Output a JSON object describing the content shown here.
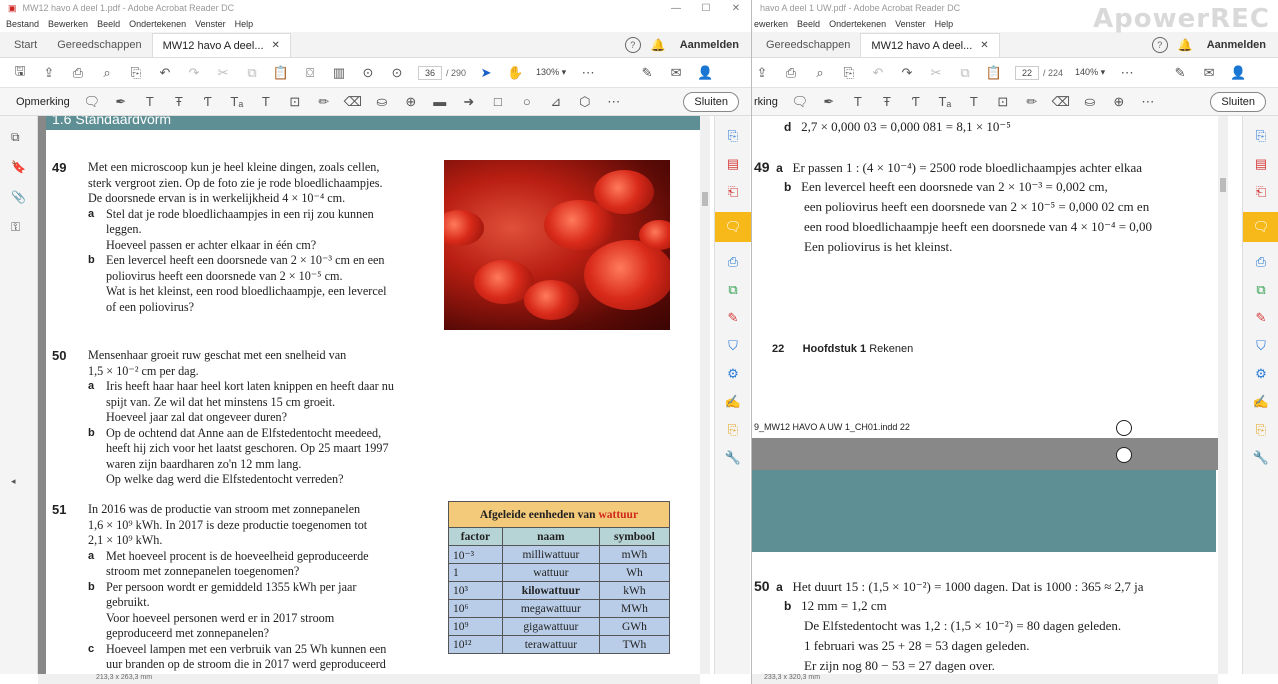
{
  "left": {
    "title": "MW12 havo A deel 1.pdf - Adobe Acrobat Reader DC",
    "menu": [
      "Bestand",
      "Bewerken",
      "Beeld",
      "Ondertekenen",
      "Venster",
      "Help"
    ],
    "tabs": [
      "Start",
      "Gereedschappen",
      "MW12 havo A deel..."
    ],
    "help_icon": "?",
    "login": "Aanmelden",
    "page_current": "36",
    "page_total": "/ 290",
    "zoom": "130%",
    "comment_label": "Opmerking",
    "close_label": "Sluiten",
    "status": "213,3 x 263,3 mm",
    "section": "1.6   Standaardvorm",
    "ex49": {
      "num": "49",
      "intro": [
        "Met een microscoop kun je heel kleine dingen, zoals cellen,",
        "sterk vergroot zien. Op de foto zie je rode bloedlichaampjes.",
        "De doorsnede ervan is in werkelijkheid 4 × 10⁻⁴ cm."
      ],
      "a_label": "a",
      "a": [
        "Stel dat je rode bloedlichaampjes in een rij zou kunnen",
        "leggen.",
        "Hoeveel passen er achter elkaar in één cm?"
      ],
      "b_label": "b",
      "b": [
        "Een levercel heeft een doorsnede van 2 × 10⁻³ cm en een",
        "poliovirus heeft een doorsnede van 2 × 10⁻⁵ cm.",
        "Wat is het kleinst, een rood bloedlichaampje, een levercel",
        "of een poliovirus?"
      ]
    },
    "ex50": {
      "num": "50",
      "intro": [
        "Mensenhaar groeit ruw geschat met een snelheid van",
        "1,5 × 10⁻² cm per dag."
      ],
      "a_label": "a",
      "a": [
        "Iris heeft haar haar heel kort laten knippen en heeft daar nu",
        "spijt van. Ze wil dat het minstens 15 cm groeit.",
        "Hoeveel jaar zal dat ongeveer duren?"
      ],
      "b_label": "b",
      "b": [
        "Op de ochtend dat Anne aan de Elfstedentocht meedeed,",
        "heeft hij zich voor het laatst geschoren. Op 25 maart 1997",
        "waren zijn baardharen zo'n 12 mm lang.",
        "Op welke dag werd die Elfstedentocht verreden?"
      ]
    },
    "ex51": {
      "num": "51",
      "intro": [
        "In 2016 was de productie van stroom met zonnepanelen",
        "1,6 × 10⁹ kWh. In 2017 is deze productie toegenomen tot",
        "2,1 × 10⁹ kWh."
      ],
      "a_label": "a",
      "a": [
        "Met hoeveel procent is de hoeveelheid geproduceerde",
        "stroom met zonnepanelen toegenomen?"
      ],
      "b_label": "b",
      "b": [
        "Per persoon wordt er gemiddeld 1355 kWh per jaar",
        "gebruikt.",
        "Voor hoeveel personen werd er in 2017 stroom",
        "geproduceerd met zonnepanelen?"
      ],
      "c_label": "c",
      "c": [
        "Hoeveel lampen met een verbruik van 25 Wh kunnen een",
        "uur branden op de stroom die in 2017 werd geproduceerd"
      ]
    },
    "table": {
      "caption_pre": "Afgeleide eenheden van ",
      "caption_red": "wattuur",
      "headers": [
        "factor",
        "naam",
        "symbool"
      ],
      "rows": [
        [
          "10⁻³",
          "milliwattuur",
          "mWh"
        ],
        [
          "1",
          "wattuur",
          "Wh"
        ],
        [
          "10³",
          "kilowattuur",
          "kWh"
        ],
        [
          "10⁶",
          "megawattuur",
          "MWh"
        ],
        [
          "10⁹",
          "gigawattuur",
          "GWh"
        ],
        [
          "10¹²",
          "terawattuur",
          "TWh"
        ]
      ]
    }
  },
  "right": {
    "title": "havo A deel 1 UW.pdf - Adobe Acrobat Reader DC",
    "menu": [
      "ewerken",
      "Beeld",
      "Ondertekenen",
      "Venster",
      "Help"
    ],
    "tabs": [
      "Gereedschappen",
      "MW12 havo A deel..."
    ],
    "help_icon": "?",
    "login": "Aanmelden",
    "page_current": "22",
    "page_total": "/ 224",
    "zoom": "140%",
    "comment_label": "rking",
    "close_label": "Sluiten",
    "status": "233,3 x 320,3 mm",
    "watermark": "ApowerREC",
    "line_d": "2,7 × 0,000 03 = 0,000 081 = 8,1 × 10⁻⁵",
    "d_label": "d",
    "a49_num": "49",
    "a49_a_label": "a",
    "a49_a": "Er passen 1 : (4 × 10⁻⁴) = 2500 rode bloedlichaampjes achter elkaa",
    "a49_b_label": "b",
    "a49_b": [
      "Een levercel heeft een doorsnede van 2 × 10⁻³ = 0,002 cm,",
      "een poliovirus heeft een doorsnede van 2 × 10⁻⁵ = 0,000 02 cm en",
      "een rood bloedlichaampje heeft een doorsnede van 4 × 10⁻⁴ = 0,00",
      "Een poliovirus is het kleinst."
    ],
    "footer_page": "22",
    "footer_chapter_bold": "Hoofdstuk 1",
    "footer_chapter": "Rekenen",
    "indd": "9_MW12 HAVO A UW 1_CH01.indd   22",
    "a50_num": "50",
    "a50_a_label": "a",
    "a50_a": "Het duurt 15 : (1,5 × 10⁻²) = 1000 dagen. Dat is 1000 : 365 ≈ 2,7 ja",
    "a50_b_label": "b",
    "a50_b": [
      "12 mm = 1,2 cm",
      "De Elfstedentocht was 1,2 : (1,5 × 10⁻²) = 80 dagen geleden.",
      "1 februari was 25 + 28 = 53 dagen geleden.",
      "Er zijn nog 80 − 53 = 27 dagen over."
    ]
  },
  "colors": {
    "section_bar": "#5d8f95",
    "comment_active": "#f7b81a",
    "table_caption": "#f3c97a",
    "table_header": "#b6d3d6",
    "table_cell": "#b9cde8",
    "red_text": "#d0281c"
  }
}
